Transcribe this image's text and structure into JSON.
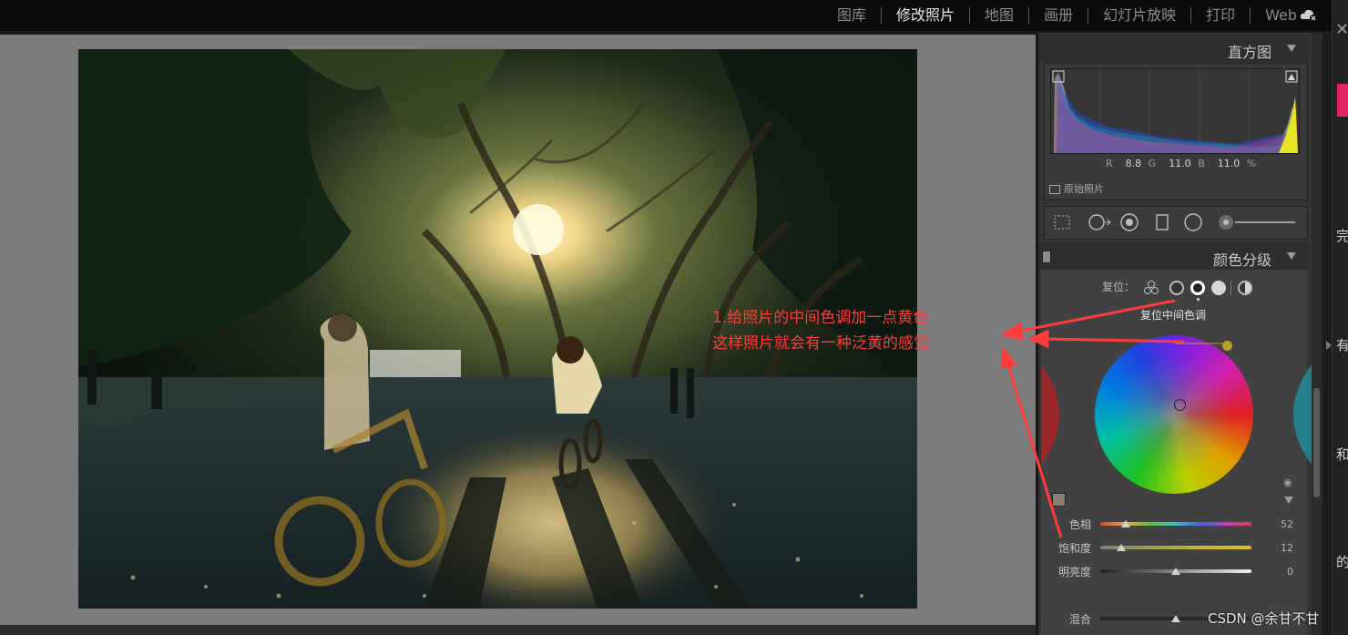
{
  "modules": [
    "图库",
    "修改照片",
    "地图",
    "画册",
    "幻灯片放映",
    "打印",
    "Web"
  ],
  "active_module": "修改照片",
  "histogram": {
    "title": "直方图",
    "r_label": "R",
    "r_value": "8.8",
    "g_label": "G",
    "g_value": "11.0",
    "b_label": "B",
    "b_value": "11.0",
    "unit": "%",
    "original_photo_label": "原始照片"
  },
  "color_grading": {
    "title": "颜色分级",
    "reset_label": "复位：",
    "mode_caption": "复位中间色调",
    "sliders": [
      {
        "label": "色相",
        "value": "52",
        "fraction": 0.17
      },
      {
        "label": "饱和度",
        "value": "12",
        "fraction": 0.14
      },
      {
        "label": "明亮度",
        "value": "0",
        "fraction": 0.5
      }
    ],
    "blend_label": "混合"
  },
  "annotation": {
    "line1": "1.给照片的中间色调加一点黄色",
    "line2": "这样照片就会有一种泛黄的感觉"
  },
  "watermark": "CSDN @余甘不甘",
  "edge_chars": [
    "完",
    "有",
    "和",
    "的"
  ],
  "colors": {
    "annotation": "#ff3b3b",
    "accent_pink": "#e0245e",
    "midtone_knob": "#b9a02c"
  }
}
